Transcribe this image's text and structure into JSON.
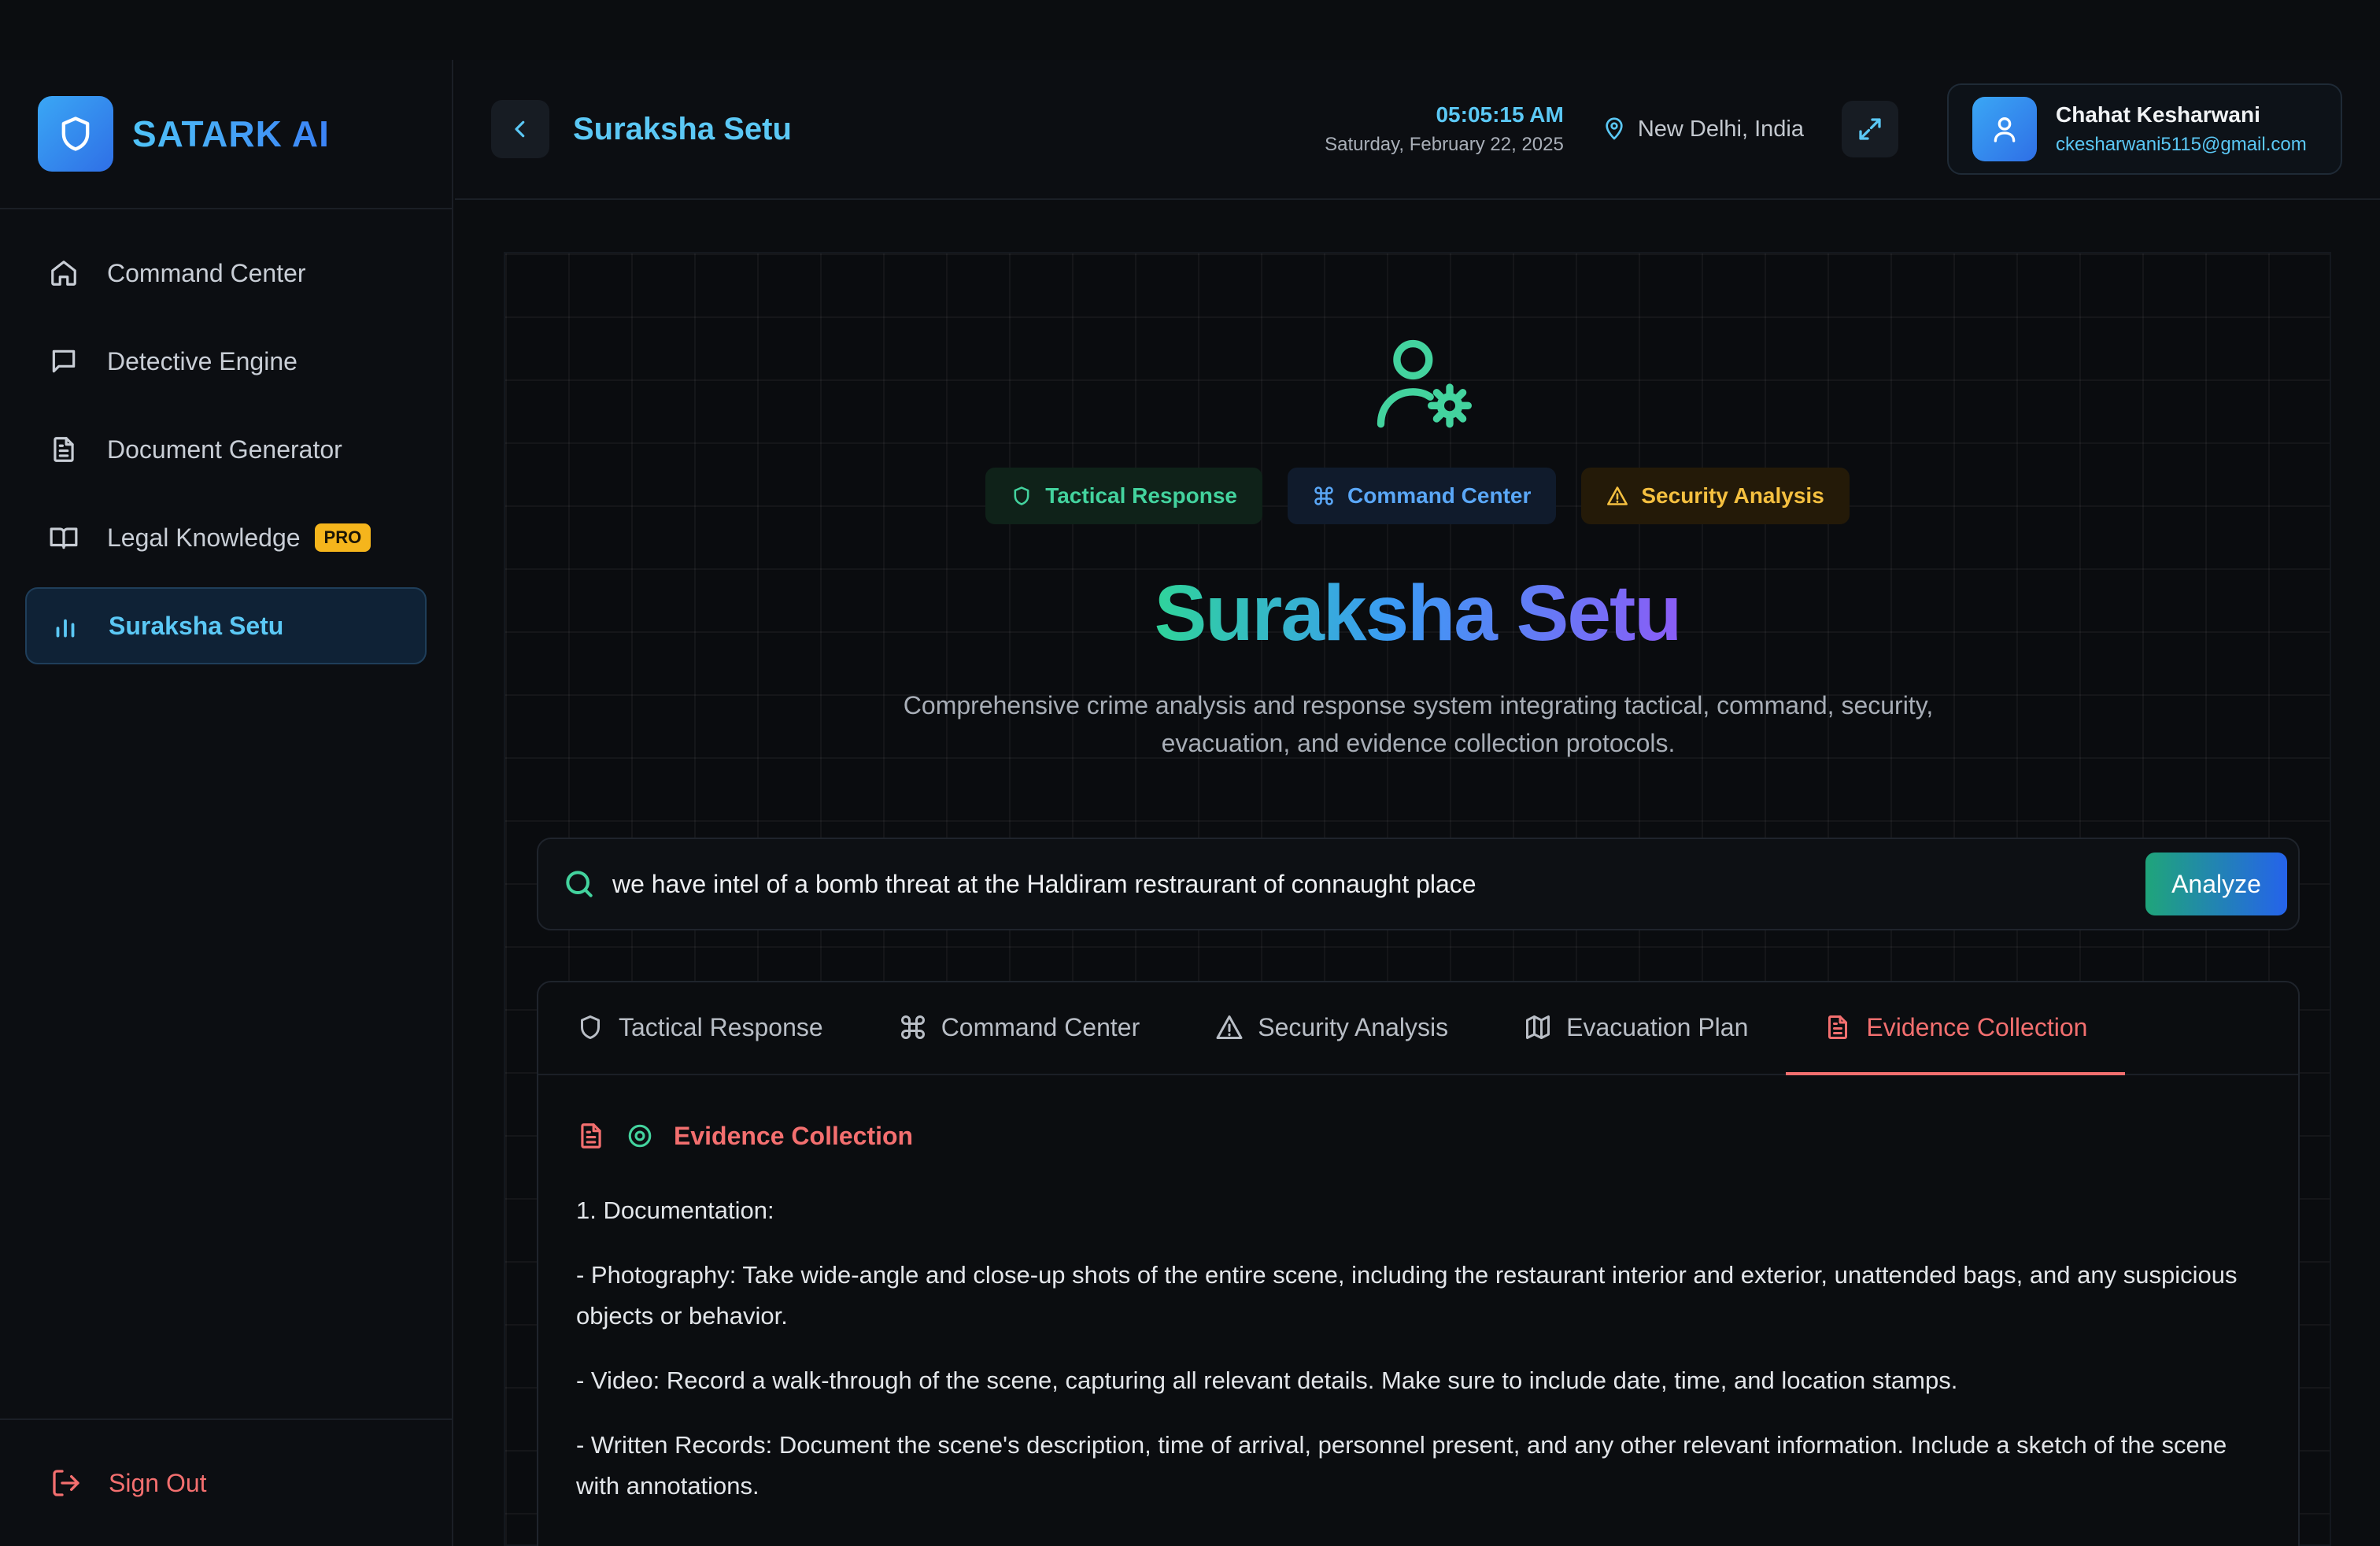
{
  "sidebar": {
    "brand": "SATARK AI",
    "items": [
      {
        "label": "Command Center",
        "icon": "home-icon"
      },
      {
        "label": "Detective Engine",
        "icon": "chat-icon"
      },
      {
        "label": "Document Generator",
        "icon": "document-icon"
      },
      {
        "label": "Legal Knowledge",
        "icon": "book-icon",
        "badge": "PRO"
      },
      {
        "label": "Suraksha Setu",
        "icon": "bar-chart-icon",
        "active": true
      }
    ],
    "sign_out": "Sign Out"
  },
  "header": {
    "title": "Suraksha Setu",
    "time": "05:05:15 AM",
    "date": "Saturday, February 22, 2025",
    "location": "New Delhi, India",
    "user_name": "Chahat Kesharwani",
    "user_email": "ckesharwani5115@gmail.com"
  },
  "hero": {
    "chips": [
      "Tactical Response",
      "Command Center",
      "Security Analysis"
    ],
    "title": "Suraksha Setu",
    "description": "Comprehensive crime analysis and response system integrating tactical, command, security, evacuation, and evidence collection protocols."
  },
  "search": {
    "value": "we have intel of a bomb threat at the Haldiram restraurant of connaught place",
    "button": "Analyze"
  },
  "tabs": [
    "Tactical Response",
    "Command Center",
    "Security Analysis",
    "Evacuation Plan",
    "Evidence Collection"
  ],
  "active_tab": "Evidence Collection",
  "result": {
    "heading": "Evidence Collection",
    "paragraphs": [
      "1. Documentation:",
      "- Photography: Take wide-angle and close-up shots of the entire scene, including the restaurant interior and exterior, unattended bags, and any suspicious objects or behavior.",
      "- Video: Record a walk-through of the scene, capturing all relevant details. Make sure to include date, time, and location stamps.",
      "- Written Records: Document the scene's description, time of arrival, personnel present, and any other relevant information. Include a sketch of the scene with annotations."
    ]
  },
  "colors": {
    "accent": "#5bc8f5",
    "evidence": "#f36f6f",
    "tactical": "#43d39e",
    "command": "#5aa7f7",
    "security": "#f5c040",
    "pro_badge": "#f5b51c"
  }
}
